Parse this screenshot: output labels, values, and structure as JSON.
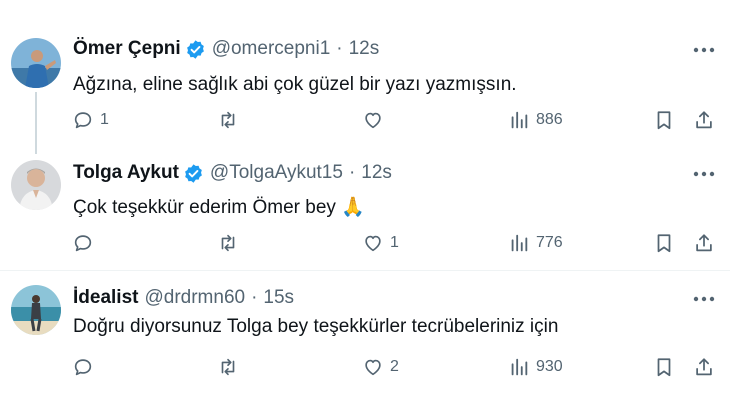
{
  "tweets": [
    {
      "name": "Ömer Çepni",
      "verified": true,
      "handle": "@omercepni1",
      "separator": "·",
      "time": "12s",
      "text": "Ağzına, eline sağlık abi çok güzel bir yazı yazmışsın.",
      "replies": "1",
      "retweets": "",
      "likes": "",
      "views": "886",
      "avatar_icon": "avatar-man-seaside"
    },
    {
      "name": "Tolga Aykut",
      "verified": true,
      "handle": "@TolgaAykut15",
      "separator": "·",
      "time": "12s",
      "text": "Çok teşekkür ederim Ömer bey 🙏",
      "replies": "",
      "retweets": "",
      "likes": "1",
      "views": "776",
      "avatar_icon": "avatar-man-portrait"
    },
    {
      "name": "İdealist",
      "verified": false,
      "handle": "@drdrmn60",
      "separator": "·",
      "time": "15s",
      "text": "Doğru diyorsunuz Tolga bey teşekkürler tecrübeleriniz için",
      "replies": "",
      "retweets": "",
      "likes": "2",
      "views": "930",
      "avatar_icon": "avatar-man-beach"
    }
  ],
  "colors": {
    "verified": "#1d9bf0",
    "text_primary": "#0f1419",
    "text_secondary": "#536471",
    "divider": "#eff3f4",
    "thread_line": "#cfd9de"
  }
}
